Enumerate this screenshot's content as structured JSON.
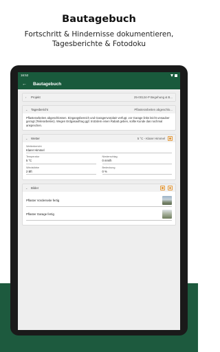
{
  "promo": {
    "title": "Bautagebuch",
    "subtitle_line1": "Fortschritt & Hindernisse dokumentieren,",
    "subtitle_line2": "Tagesberichte & Fotodoku"
  },
  "statusbar": {
    "time": "16:52"
  },
  "appbar": {
    "title": "Bautagebuch"
  },
  "project": {
    "label": "Projekt",
    "value": "25-00124-P Begehung & B..."
  },
  "daily_report": {
    "label": "Tagesbericht",
    "value": "Pflasterarbeiten abgeschlo...",
    "text": "Pflasterarbeiten abgeschlossen. Eingangsbereich und Garagenvorplatz verfugt, vor Garage links leicht unsauber gezogt (Teilerarbeiten). Wegen Erdgasauftrag ggf. trotzdem einen Rabatt geben, sollte Kunde das nochmal ansprechen."
  },
  "weather": {
    "label": "Wetter",
    "value": "5 °C - Klarer Himmel",
    "report_label": "Wetterbericht",
    "report_value": "Klarer Himmel",
    "temp_label": "Temperatur",
    "temp_value": "5 °C",
    "precip_label": "Niederschlag",
    "precip_value": "0 mm/h",
    "wind_label": "Windstärke",
    "wind_value": "2 Bft",
    "cloud_label": "Bedeckung",
    "cloud_value": "0 %"
  },
  "images": {
    "label": "Bilder",
    "items": [
      {
        "caption": "Pflaster Vorderseite fertig"
      },
      {
        "caption": "Pflaster Garage fertig"
      }
    ]
  }
}
